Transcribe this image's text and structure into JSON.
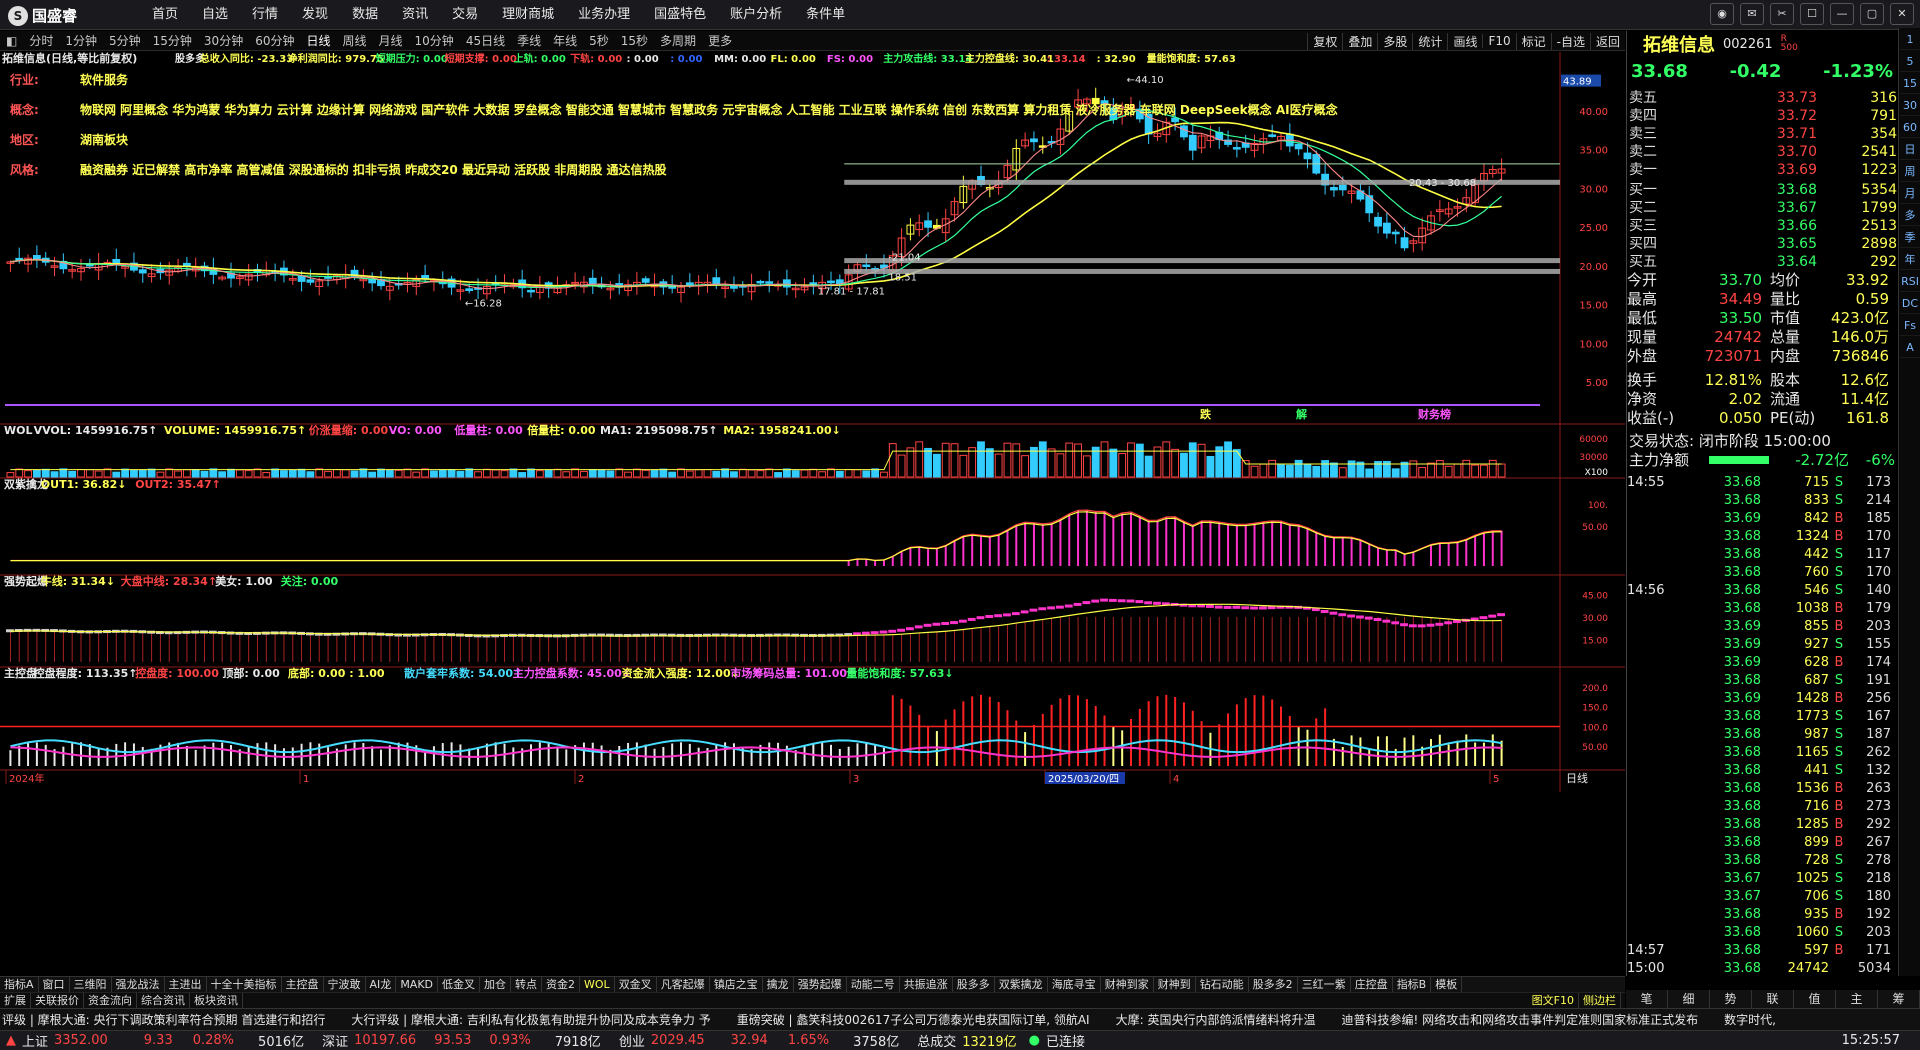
{
  "app": {
    "brand": "国盛睿",
    "menu": [
      "首页",
      "自选",
      "行情",
      "发现",
      "数据",
      "资讯",
      "交易",
      "理财商城",
      "业务办理",
      "国盛特色",
      "账户分析",
      "条件单"
    ]
  },
  "periods": [
    "分时",
    "1分钟",
    "5分钟",
    "15分钟",
    "30分钟",
    "60分钟",
    "日线",
    "周线",
    "月线",
    "10分钟",
    "45日线",
    "季线",
    "年线",
    "5秒",
    "15秒",
    "多周期",
    "更多"
  ],
  "active_period": "日线",
  "tools": [
    "复权",
    "叠加",
    "多股",
    "统计",
    "画线",
    "F10",
    "标记",
    "-自选",
    "返回"
  ],
  "header": {
    "title": "拓维信息(日线,等比前复权)",
    "fields": [
      {
        "t": "股多多",
        "c": "#e8e8e8"
      },
      {
        "t": "总收入同比: -23.33",
        "c": "#ffff55"
      },
      {
        "t": "净利润同比: 979.75",
        "c": "#ffff55"
      },
      {
        "t": "短期压力: 0.00",
        "c": "#33ff66"
      },
      {
        "t": "短期支撑: 0.00",
        "c": "#ff4444"
      },
      {
        "t": "上轨: 0.00",
        "c": "#33ff66"
      },
      {
        "t": "下轨: 0.00",
        "c": "#ff4444"
      },
      {
        "t": ": 0.00",
        "c": "#e8e8e8"
      },
      {
        "t": ": 0.00",
        "c": "#3366ff"
      },
      {
        "t": "MM: 0.00",
        "c": "#e8e8e8"
      },
      {
        "t": "FL: 0.00",
        "c": "#ffff55"
      },
      {
        "t": "FS: 0.00",
        "c": "#ff55ff"
      },
      {
        "t": "主力攻击线: 33.14",
        "c": "#33ff66"
      },
      {
        "t": "主力控盘线: 30.41",
        "c": "#ffff55"
      },
      {
        "t": ": 33.14",
        "c": "#ff4444"
      },
      {
        "t": ": 32.90",
        "c": "#ffff55"
      },
      {
        "t": "量能饱和度: 57.63",
        "c": "#ffff55"
      }
    ]
  },
  "info": [
    {
      "k": "行业:",
      "v": "软件服务"
    },
    {
      "k": "概念:",
      "v": "物联网 阿里概念 华为鸿蒙 华为算力 云计算 边缘计算 网络游戏 国产软件 大数据 罗垒概念 智能交通 智慧城市 智慧政务 元宇宙概念 人工智能 工业互联 操作系统 信创 东数西算 算力租赁 液冷服务器 车联网 DeepSeek概念 AI医疗概念"
    },
    {
      "k": "地区:",
      "v": "湖南板块"
    },
    {
      "k": "风格:",
      "v": "融资融券 近已解禁 高市净率 高管减值 深股通标的 扣非亏损 昨成交20 最近异动 活跃股 非周期股 通达信热股"
    }
  ],
  "annotations": {
    "high": "44.10",
    "low": "16.28",
    "p1": "17.81 - 17.81",
    "p2": "21.04",
    "p3": "20.43 - 30.68",
    "p4": "18.51",
    "marks": [
      "跌",
      "解",
      "财务榜"
    ]
  },
  "main_axis": {
    "labels": [
      "40.00",
      "35.00",
      "30.00",
      "25.00",
      "20.00",
      "15.00",
      "10.00",
      "5.00"
    ],
    "current": "43.89",
    "label_current": "33.68"
  },
  "vol_panel": {
    "fields": [
      {
        "t": "WOL",
        "c": "#e8e8e8"
      },
      {
        "t": "VVOL: 1459916.75↑",
        "c": "#e8e8e8"
      },
      {
        "t": "VOLUME: 1459916.75↑",
        "c": "#ffff55"
      },
      {
        "t": "价涨量缩: 0.00",
        "c": "#ff4444"
      },
      {
        "t": "VO: 0.00",
        "c": "#ff55ff"
      },
      {
        "t": "低量柱: 0.00",
        "c": "#ff55ff"
      },
      {
        "t": "倍量柱: 0.00",
        "c": "#ffff55"
      },
      {
        "t": "MA1: 2195098.75↑",
        "c": "#e8e8e8"
      },
      {
        "t": "MA2: 1958241.00↓",
        "c": "#ffff55"
      }
    ],
    "axis": [
      "60000",
      "30000",
      "X100"
    ]
  },
  "dragon_panel": {
    "fields": [
      {
        "t": "双紫擒龙",
        "c": "#e8e8e8"
      },
      {
        "t": "OUT1: 36.82↓",
        "c": "#ffff55"
      },
      {
        "t": "OUT2: 35.47↑",
        "c": "#ff4444"
      }
    ],
    "axis": [
      "100.",
      "50.00"
    ]
  },
  "strong_panel": {
    "fields": [
      {
        "t": "强势起爆",
        "c": "#e8e8e8"
      },
      {
        "t": "牛线: 31.34↓",
        "c": "#ffff55"
      },
      {
        "t": "大盘中线: 28.34↑",
        "c": "#ff4444"
      },
      {
        "t": "美女: 1.00",
        "c": "#e8e8e8"
      },
      {
        "t": "关注: 0.00",
        "c": "#33ff66"
      }
    ],
    "axis": [
      "45.00",
      "30.00",
      "15.00"
    ]
  },
  "control_panel": {
    "fields": [
      {
        "t": "主控盘",
        "c": "#e8e8e8"
      },
      {
        "t": "控盘程度: 113.35↑",
        "c": "#e8e8e8"
      },
      {
        "t": "控盘度: 100.00",
        "c": "#ff4444"
      },
      {
        "t": "顶部: 0.00",
        "c": "#e8e8e8"
      },
      {
        "t": "底部: 0.00 : 1.00",
        "c": "#ffff55"
      },
      {
        "t": "散户套牢系数: 54.00↑",
        "c": "#44ddff"
      },
      {
        "t": "主力控盘系数: 45.00↓",
        "c": "#ff55ff"
      },
      {
        "t": "资金流入强度: 12.00↓",
        "c": "#ffff55"
      },
      {
        "t": "市场筹码总量: 101.00↑",
        "c": "#ff55ff"
      },
      {
        "t": "量能饱和度: 57.63↓",
        "c": "#33ff66"
      }
    ],
    "axis": [
      "200.0",
      "150.0",
      "100.0",
      "50.00"
    ]
  },
  "x_axis": {
    "labels": [
      "2024年",
      "1",
      "2",
      "3",
      "2025/03/20/四",
      "4",
      "5"
    ],
    "right_label": "日线"
  },
  "ind_tabs": [
    "指标A",
    "窗口",
    "三维阳",
    "强龙战法",
    "主进出",
    "十全十美指标",
    "主控盘",
    "宁波敢",
    "AI龙",
    "MAKD",
    "低金叉",
    "加仓",
    "转点",
    "资金2",
    "WOL",
    "双金叉",
    "凡客起爆",
    "镇店之宝",
    "擒龙",
    "强势起爆",
    "动能二号",
    "共振追涨",
    "股多多",
    "双紫擒龙",
    "海底寻宝",
    "财神到家",
    "财神到",
    "钻石动能",
    "股多多2",
    "三红一紫",
    "庄控盘",
    "指标B",
    "模板"
  ],
  "sub_tabs": [
    "扩展",
    "关联报价",
    "资金流向",
    "综合资讯",
    "板块资讯"
  ],
  "sub_tabs_right": [
    "图文F10",
    "侧边栏"
  ],
  "quote": {
    "name": "拓维信息",
    "code": "002261",
    "market": "R\n500",
    "price": "33.68",
    "change": "-0.42",
    "pct": "-1.23%",
    "asks": [
      {
        "l": "卖五",
        "p": "33.73",
        "v": "316"
      },
      {
        "l": "卖四",
        "p": "33.72",
        "v": "791"
      },
      {
        "l": "卖三",
        "p": "33.71",
        "v": "354"
      },
      {
        "l": "卖二",
        "p": "33.70",
        "v": "2541"
      },
      {
        "l": "卖一",
        "p": "33.69",
        "v": "1223"
      }
    ],
    "bids": [
      {
        "l": "买一",
        "p": "33.68",
        "v": "5354"
      },
      {
        "l": "买二",
        "p": "33.67",
        "v": "1799"
      },
      {
        "l": "买三",
        "p": "33.66",
        "v": "2513"
      },
      {
        "l": "买四",
        "p": "33.65",
        "v": "2898"
      },
      {
        "l": "买五",
        "p": "33.64",
        "v": "292"
      }
    ],
    "stats": [
      {
        "k": "今开",
        "v": "33.70",
        "vc": "grn",
        "k2": "均价",
        "v2": "33.92"
      },
      {
        "k": "最高",
        "v": "34.49",
        "vc": "red",
        "k2": "量比",
        "v2": "0.59"
      },
      {
        "k": "最低",
        "v": "33.50",
        "vc": "grn",
        "k2": "市值",
        "v2": "423.0亿"
      },
      {
        "k": "现量",
        "v": "24742",
        "vc": "red",
        "k2": "总量",
        "v2": "146.0万"
      },
      {
        "k": "外盘",
        "v": "723071",
        "vc": "red",
        "k2": "内盘",
        "v2": "736846"
      }
    ],
    "stats2": [
      {
        "k": "换手",
        "v": "12.81%",
        "k2": "股本",
        "v2": "12.6亿"
      },
      {
        "k": "净资",
        "v": "2.02",
        "k2": "流通",
        "v2": "11.4亿"
      },
      {
        "k": "收益(-)",
        "v": "0.050",
        "k2": "PE(动)",
        "v2": "161.8"
      }
    ],
    "status": "交易状态: 闭市阶段 15:00:00",
    "netflow_label": "主力净额",
    "netflow": "-2.72亿",
    "netflow_pct": "-6%"
  },
  "ticks": [
    {
      "t": "14:55",
      "p": "33.68",
      "v": "715",
      "d": "S",
      "n": "173"
    },
    {
      "t": "",
      "p": "33.68",
      "v": "833",
      "d": "S",
      "n": "214"
    },
    {
      "t": "",
      "p": "33.69",
      "v": "842",
      "d": "B",
      "n": "185"
    },
    {
      "t": "",
      "p": "33.68",
      "v": "1324",
      "d": "B",
      "n": "170"
    },
    {
      "t": "",
      "p": "33.68",
      "v": "442",
      "d": "S",
      "n": "117"
    },
    {
      "t": "",
      "p": "33.68",
      "v": "760",
      "d": "S",
      "n": "170"
    },
    {
      "t": "14:56",
      "p": "33.68",
      "v": "546",
      "d": "S",
      "n": "140"
    },
    {
      "t": "",
      "p": "33.68",
      "v": "1038",
      "d": "B",
      "n": "179"
    },
    {
      "t": "",
      "p": "33.69",
      "v": "855",
      "d": "B",
      "n": "203"
    },
    {
      "t": "",
      "p": "33.69",
      "v": "927",
      "d": "S",
      "n": "155"
    },
    {
      "t": "",
      "p": "33.69",
      "v": "628",
      "d": "B",
      "n": "174"
    },
    {
      "t": "",
      "p": "33.68",
      "v": "687",
      "d": "S",
      "n": "191"
    },
    {
      "t": "",
      "p": "33.69",
      "v": "1428",
      "d": "B",
      "n": "256"
    },
    {
      "t": "",
      "p": "33.68",
      "v": "1773",
      "d": "S",
      "n": "167"
    },
    {
      "t": "",
      "p": "33.68",
      "v": "987",
      "d": "S",
      "n": "187"
    },
    {
      "t": "",
      "p": "33.68",
      "v": "1165",
      "d": "S",
      "n": "262"
    },
    {
      "t": "",
      "p": "33.68",
      "v": "441",
      "d": "S",
      "n": "132"
    },
    {
      "t": "",
      "p": "33.68",
      "v": "1536",
      "d": "B",
      "n": "263"
    },
    {
      "t": "",
      "p": "33.68",
      "v": "716",
      "d": "B",
      "n": "273"
    },
    {
      "t": "",
      "p": "33.68",
      "v": "1285",
      "d": "B",
      "n": "292"
    },
    {
      "t": "",
      "p": "33.68",
      "v": "899",
      "d": "B",
      "n": "267"
    },
    {
      "t": "",
      "p": "33.68",
      "v": "728",
      "d": "S",
      "n": "278"
    },
    {
      "t": "",
      "p": "33.67",
      "v": "1025",
      "d": "S",
      "n": "218"
    },
    {
      "t": "",
      "p": "33.67",
      "v": "706",
      "d": "S",
      "n": "180"
    },
    {
      "t": "",
      "p": "33.68",
      "v": "935",
      "d": "B",
      "n": "192"
    },
    {
      "t": "",
      "p": "33.68",
      "v": "1060",
      "d": "S",
      "n": "203"
    },
    {
      "t": "14:57",
      "p": "33.68",
      "v": "597",
      "d": "B",
      "n": "171"
    },
    {
      "t": "15:00",
      "p": "33.68",
      "v": "24742",
      "d": "",
      "n": "5034"
    }
  ],
  "right_tabs": [
    "笔",
    "细",
    "势",
    "联",
    "值",
    "主",
    "筹"
  ],
  "sidebar": [
    "1",
    "5",
    "15",
    "30",
    "60",
    "日",
    "周",
    "月",
    "多",
    "季",
    "年",
    "RSI",
    "DC",
    "Fs",
    "A"
  ],
  "news": [
    "评级 | 摩根大通: 央行下调政策利率符合预期 首选建行和招行",
    "大行评级 | 摩根大通: 吉利私有化极氪有助提升协同及成本竞争力 予",
    "重磅突破 | 蠡笑科技002617子公司万德泰光电获国际订单, 领航AI",
    "大摩: 英国央行内部鸽派情绪料将升温",
    "迪普科技参编! 网络攻击和网络攻击事件判定准则国家标准正式发布",
    "数字时代,"
  ],
  "statusbar": {
    "sh_label": "上证",
    "sh": "3352.00",
    "sh_chg": "9.33",
    "sh_pct": "0.28%",
    "sh_amt": "5016亿",
    "sz_label": "深证",
    "sz": "10197.66",
    "sz_chg": "93.53",
    "sz_pct": "0.93%",
    "sz_amt": "7918亿",
    "cy_label": "创业",
    "cy": "2029.45",
    "cy_chg": "32.94",
    "cy_pct": "1.65%",
    "cy_amt": "3758亿",
    "total_label": "总成交",
    "total": "13219亿",
    "conn": "已连接",
    "time": "15:25:57"
  },
  "colors": {
    "up": "#ff4444",
    "down": "#33ff66",
    "ma_yellow": "#ffff44",
    "accent": "#ffff55"
  }
}
